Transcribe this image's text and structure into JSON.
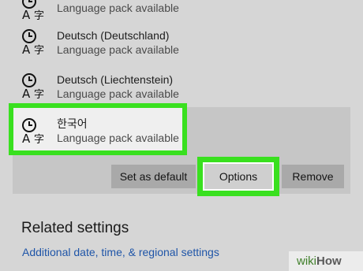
{
  "languages": [
    {
      "name": "",
      "status": "Language pack available"
    },
    {
      "name": "Deutsch (Deutschland)",
      "status": "Language pack available"
    },
    {
      "name": "Deutsch (Liechtenstein)",
      "status": "Language pack available"
    },
    {
      "name": "한국어",
      "status": "Language pack available"
    }
  ],
  "buttons": {
    "set_default": "Set as default",
    "options": "Options",
    "remove": "Remove"
  },
  "related": {
    "heading": "Related settings",
    "link": "Additional date, time, & regional settings"
  },
  "watermark": {
    "wiki": "wiki",
    "how": "How"
  },
  "colors": {
    "highlight": "#39e01f",
    "link": "#1f55a8",
    "background": "#d6d6d6"
  },
  "icons": {
    "language": "language-pack-icon"
  }
}
